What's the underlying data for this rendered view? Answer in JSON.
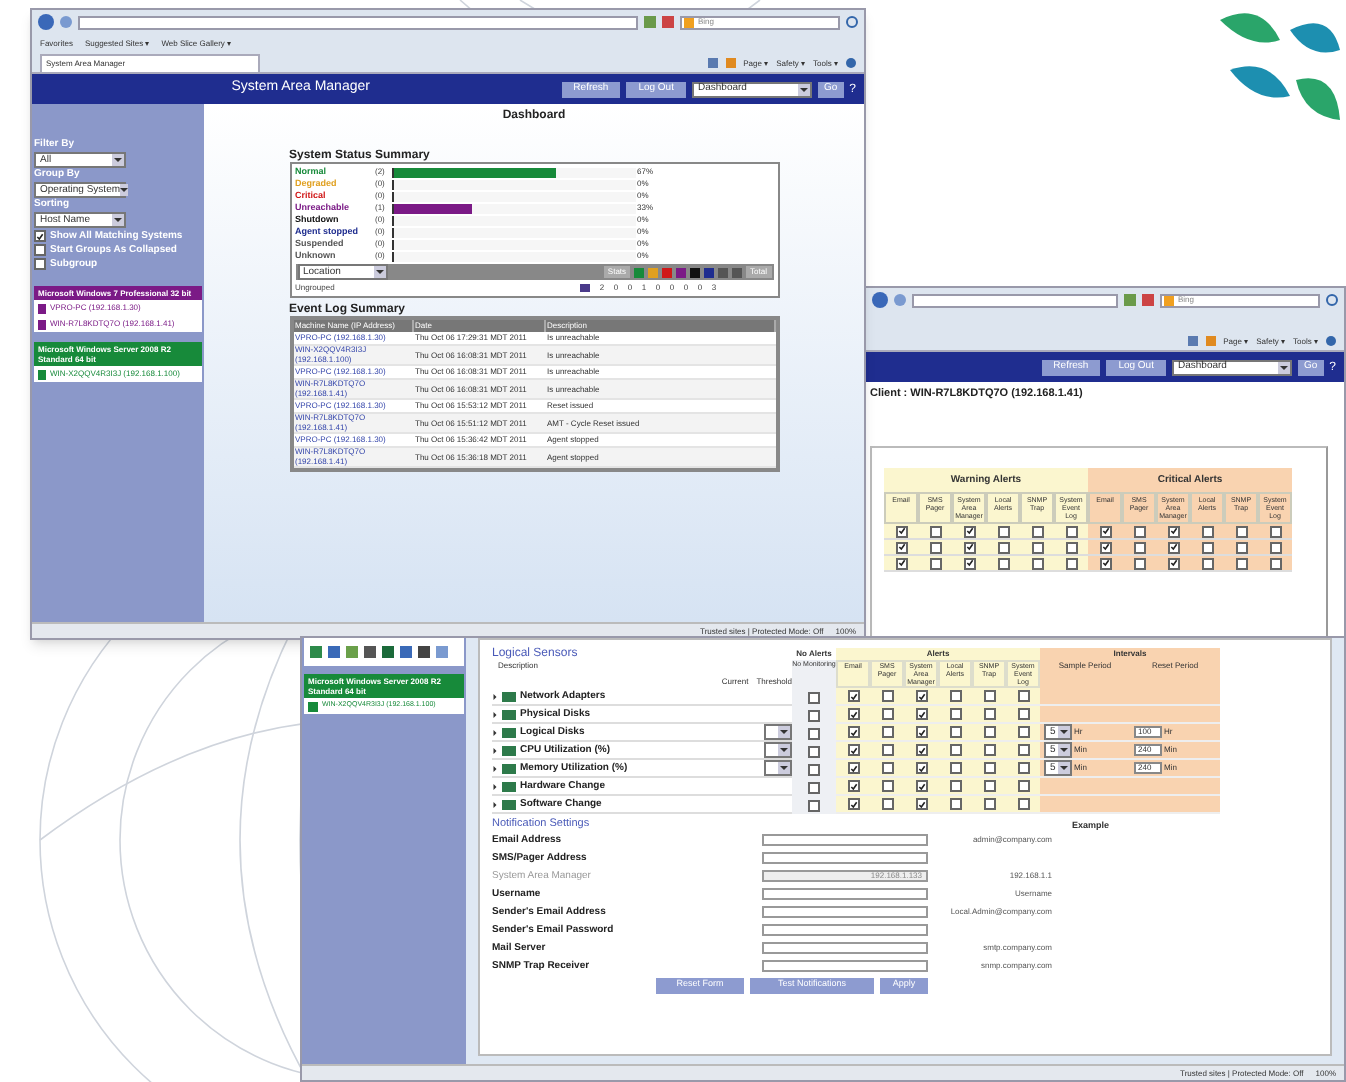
{
  "dashboard_window": {
    "search_placeholder": "Bing",
    "favorites": [
      "Favorites",
      "Suggested Sites ▾",
      "Web Slice Gallery ▾"
    ],
    "tab": "System Area Manager",
    "command_menu": [
      "Page ▾",
      "Safety ▾",
      "Tools ▾"
    ],
    "header": {
      "title": "System Area Manager",
      "buttons": [
        "Refresh",
        "Log Out"
      ],
      "view_select": "Dashboard",
      "go": "Go",
      "help": "?"
    },
    "sidebar": {
      "filters": [
        {
          "label": "Filter By",
          "value": "All"
        },
        {
          "label": "Group By",
          "value": "Operating System"
        },
        {
          "label": "Sorting",
          "value": "Host Name"
        }
      ],
      "options": [
        {
          "label": "Show All Matching Systems",
          "checked": true
        },
        {
          "label": "Start Groups As Collapsed",
          "checked": false
        },
        {
          "label": "Subgroup",
          "checked": false
        }
      ],
      "groups": [
        {
          "name": "Microsoft Windows 7 Professional 32 bit",
          "color": "#7b1a86",
          "systems": [
            "VPRO-PC (192.168.1.30)",
            "WIN-R7L8KDTQ7O (192.168.1.41)"
          ]
        },
        {
          "name": "Microsoft Windows Server 2008 R2 Standard 64 bit",
          "color": "#178a3a",
          "systems": [
            "WIN-X2QQV4R3I3J (192.168.1.100)"
          ]
        }
      ]
    },
    "page_title": "Dashboard",
    "status_summary": {
      "title": "System Status Summary",
      "rows": [
        {
          "label": "Normal",
          "count": "(2)",
          "percent": "67%",
          "level": 0.67,
          "color": "#178a3a"
        },
        {
          "label": "Degraded",
          "count": "(0)",
          "percent": "0%",
          "level": 0,
          "color": "#e0a020"
        },
        {
          "label": "Critical",
          "count": "(0)",
          "percent": "0%",
          "level": 0,
          "color": "#d01818"
        },
        {
          "label": "Unreachable",
          "count": "(1)",
          "percent": "33%",
          "level": 0.33,
          "color": "#7b1a86"
        },
        {
          "label": "Shutdown",
          "count": "(0)",
          "percent": "0%",
          "level": 0,
          "color": "#111111"
        },
        {
          "label": "Agent stopped",
          "count": "(0)",
          "percent": "0%",
          "level": 0,
          "color": "#1f2d8f"
        },
        {
          "label": "Suspended",
          "count": "(0)",
          "percent": "0%",
          "level": 0,
          "color": "#555555"
        },
        {
          "label": "Unknown",
          "count": "(0)",
          "percent": "0%",
          "level": 0,
          "color": "#555555"
        }
      ],
      "location_select": "Location",
      "stats": "Stats",
      "total": "Total",
      "ungrouped": {
        "label": "Ungrouped",
        "counts": [
          "2",
          "0",
          "0",
          "1",
          "0",
          "0",
          "0",
          "0",
          "3"
        ]
      }
    },
    "event_log": {
      "title": "Event Log Summary",
      "columns": [
        "Machine Name (IP Address)",
        "Date",
        "Description"
      ],
      "rows": [
        {
          "machine": "VPRO-PC (192.168.1.30)",
          "date": "Thu Oct 06 17:29:31 MDT 2011",
          "description": "Is unreachable"
        },
        {
          "machine": "WIN-X2QQV4R3I3J (192.168.1.100)",
          "date": "Thu Oct 06 16:08:31 MDT 2011",
          "description": "Is unreachable"
        },
        {
          "machine": "VPRO-PC (192.168.1.30)",
          "date": "Thu Oct 06 16:08:31 MDT 2011",
          "description": "Is unreachable"
        },
        {
          "machine": "WIN-R7L8KDTQ7O (192.168.1.41)",
          "date": "Thu Oct 06 16:08:31 MDT 2011",
          "description": "Is unreachable"
        },
        {
          "machine": "VPRO-PC (192.168.1.30)",
          "date": "Thu Oct 06 15:53:12 MDT 2011",
          "description": "Reset issued"
        },
        {
          "machine": "WIN-R7L8KDTQ7O (192.168.1.41)",
          "date": "Thu Oct 06 15:51:12 MDT 2011",
          "description": "AMT - Cycle Reset issued"
        },
        {
          "machine": "VPRO-PC (192.168.1.30)",
          "date": "Thu Oct 06 15:36:42 MDT 2011",
          "description": "Agent stopped"
        },
        {
          "machine": "WIN-R7L8KDTQ7O (192.168.1.41)",
          "date": "Thu Oct 06 15:36:18 MDT 2011",
          "description": "Agent stopped"
        }
      ]
    },
    "status_bar": {
      "zone": "Trusted sites | Protected Mode: Off",
      "zoom": "100%"
    }
  },
  "alerts_window": {
    "search_placeholder": "Bing",
    "command_menu": [
      "Page ▾",
      "Safety ▾",
      "Tools ▾"
    ],
    "header": {
      "buttons": [
        "Refresh",
        "Log Out"
      ],
      "view_select": "Dashboard",
      "go": "Go",
      "help": "?"
    },
    "client": "Client : WIN-R7L8KDTQ7O (192.168.1.41)",
    "groups": [
      {
        "title": "Warning Alerts",
        "columns": [
          "Email",
          "SMS Pager",
          "System Area Manager",
          "Local Alerts",
          "SNMP Trap",
          "System Event Log"
        ]
      },
      {
        "title": "Critical Alerts",
        "columns": [
          "Email",
          "SMS Pager",
          "System Area Manager",
          "Local Alerts",
          "SNMP Trap",
          "System Event Log"
        ]
      }
    ],
    "rows": [
      {
        "checks": [
          true,
          false,
          true,
          false,
          false,
          false,
          true,
          false,
          true,
          false,
          false,
          false
        ]
      },
      {
        "checks": [
          true,
          false,
          true,
          false,
          false,
          false,
          true,
          false,
          true,
          false,
          false,
          false
        ]
      },
      {
        "checks": [
          true,
          false,
          true,
          false,
          false,
          false,
          true,
          false,
          true,
          false,
          false,
          false
        ]
      }
    ]
  },
  "sensors_window": {
    "sidebar": {
      "group": "Microsoft Windows Server 2008 R2 Standard 64 bit",
      "system": "WIN-X2QQV4R3I3J (192.168.1.100)"
    },
    "title": "Logical Sensors",
    "headers": {
      "description": "Description",
      "current": "Current",
      "threshold": "Threshold",
      "no_alerts": "No Alerts",
      "no_monitoring": "No Monitoring",
      "alerts": "Alerts",
      "alert_columns": [
        "Email",
        "SMS Pager",
        "System Area Manager",
        "Local Alerts",
        "SNMP Trap",
        "System Event Log"
      ],
      "intervals": "Intervals",
      "sample": "Sample Period",
      "reset": "Reset Period"
    },
    "rows": [
      {
        "name": "Network Adapters",
        "kind": "plain",
        "no_monitoring": false,
        "alerts": [
          true,
          false,
          true,
          false,
          false,
          false
        ]
      },
      {
        "name": "Physical Disks",
        "kind": "plain",
        "no_monitoring": false,
        "alerts": [
          true,
          false,
          true,
          false,
          false,
          false
        ]
      },
      {
        "name": "Logical Disks",
        "kind": "threshold",
        "no_monitoring": false,
        "alerts": [
          true,
          false,
          true,
          false,
          false,
          false
        ],
        "sample": "5",
        "sample_unit": "Hr",
        "reset": "100",
        "reset_unit": "Hr"
      },
      {
        "name": "CPU Utilization (%)",
        "kind": "threshold",
        "no_monitoring": false,
        "alerts": [
          true,
          false,
          true,
          false,
          false,
          false
        ],
        "sample": "5",
        "sample_unit": "Min",
        "reset": "240",
        "reset_unit": "Min"
      },
      {
        "name": "Memory Utilization (%)",
        "kind": "threshold",
        "no_monitoring": false,
        "alerts": [
          true,
          false,
          true,
          false,
          false,
          false
        ],
        "sample": "5",
        "sample_unit": "Min",
        "reset": "240",
        "reset_unit": "Min"
      },
      {
        "name": "Hardware Change",
        "kind": "plain",
        "no_monitoring": false,
        "alerts": [
          true,
          false,
          true,
          false,
          false,
          false
        ]
      },
      {
        "name": "Software Change",
        "kind": "plain",
        "no_monitoring": false,
        "alerts": [
          true,
          false,
          true,
          false,
          false,
          false
        ]
      }
    ],
    "notification": {
      "title": "Notification Settings",
      "example_header": "Example",
      "fields": [
        {
          "label": "Email Address",
          "disabled": false,
          "example": "admin@company.com"
        },
        {
          "label": "SMS/Pager Address",
          "disabled": false
        },
        {
          "label": "System Area Manager",
          "disabled": true,
          "placeholder": "192.168.1.133",
          "example": "192.168.1.1"
        },
        {
          "label": "Username",
          "disabled": false,
          "example": "Username"
        },
        {
          "label": "Sender's Email Address",
          "disabled": false,
          "example": "Local.Admin@company.com"
        },
        {
          "label": "Sender's Email Password",
          "disabled": false
        },
        {
          "label": "Mail Server",
          "disabled": false,
          "example": "smtp.company.com"
        },
        {
          "label": "SNMP Trap Receiver",
          "disabled": false,
          "example": "snmp.company.com"
        }
      ]
    },
    "buttons": [
      "Reset Form",
      "Test Notifications",
      "Apply"
    ],
    "status_bar": {
      "zone": "Trusted sites | Protected Mode: Off",
      "zoom": "100%"
    }
  }
}
